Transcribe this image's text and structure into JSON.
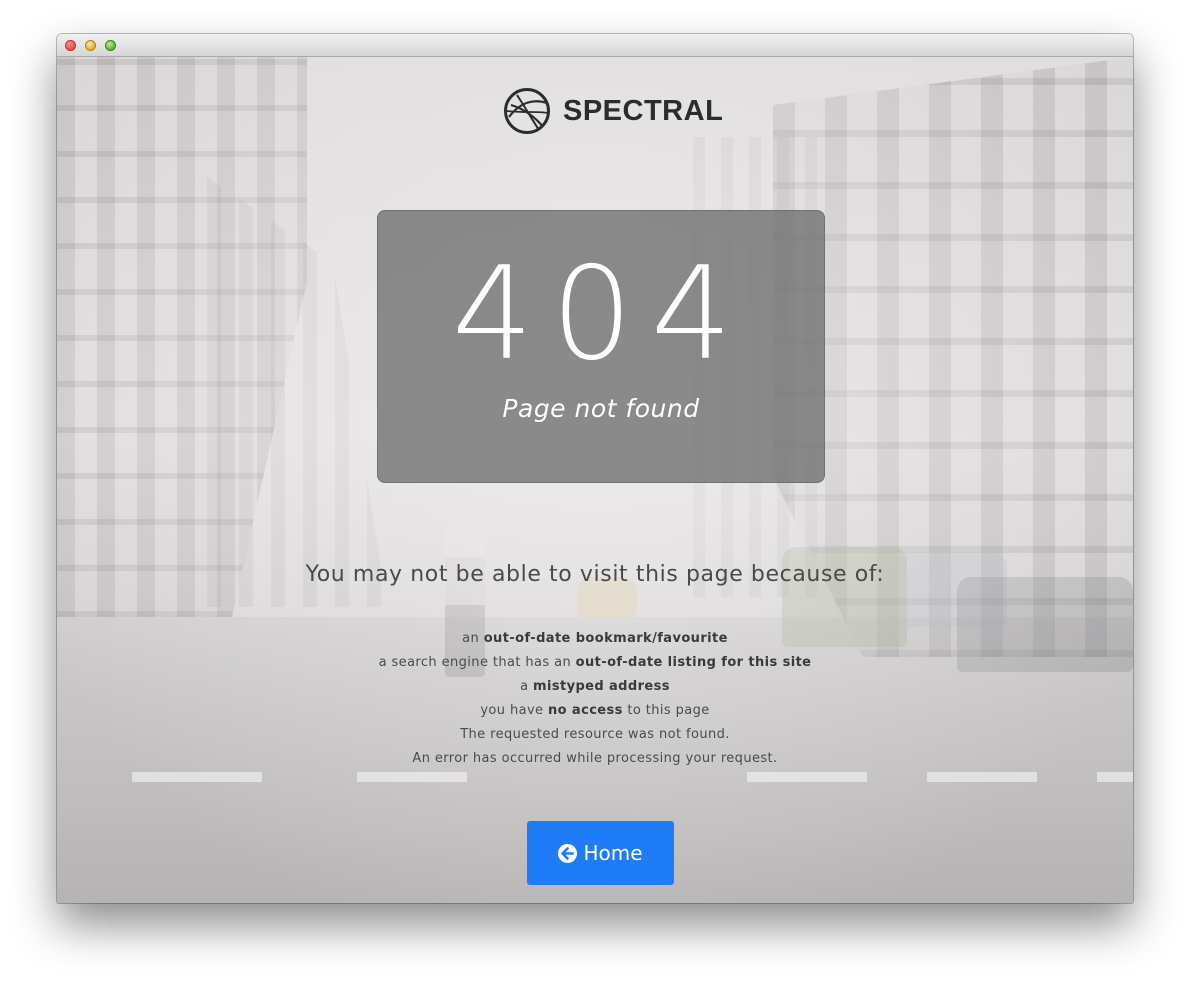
{
  "brand": {
    "name": "SPECTRAL"
  },
  "error": {
    "code": "404",
    "message": "Page not found"
  },
  "reasons": {
    "heading": "You may not be able to visit this page because of:",
    "items": [
      {
        "pre": "an ",
        "bold": "out-of-date bookmark/favourite",
        "post": ""
      },
      {
        "pre": "a search engine that has an ",
        "bold": "out-of-date listing for this site",
        "post": ""
      },
      {
        "pre": "a ",
        "bold": "mistyped address",
        "post": ""
      },
      {
        "pre": "you have ",
        "bold": "no access",
        "post": " to this page"
      },
      {
        "pre": "The requested resource was not found.",
        "bold": "",
        "post": ""
      },
      {
        "pre": "An error has occurred while processing your request.",
        "bold": "",
        "post": ""
      }
    ]
  },
  "home_button": {
    "label": "Home",
    "icon": "arrow-circle-left-icon"
  },
  "colors": {
    "accent": "#1e7cf7",
    "panel": "#6e6e6e"
  }
}
